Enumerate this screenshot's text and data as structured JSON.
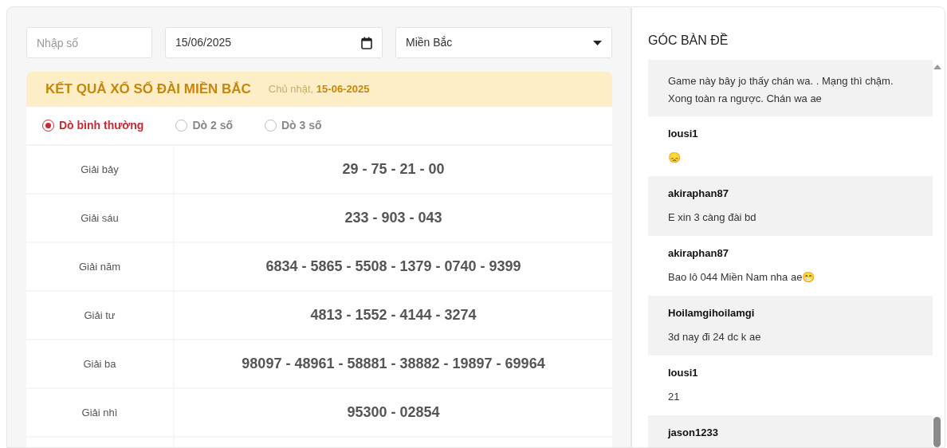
{
  "filters": {
    "number": {
      "placeholder": "Nhập số"
    },
    "date": {
      "value": "15/06/2025"
    },
    "region": {
      "value": "Miền Bắc"
    }
  },
  "results": {
    "title": "KẾT QUẢ XỔ SỐ ĐÀI MIỀN BẮC",
    "day": "Chủ nhật,",
    "date": "15-06-2025",
    "modes": [
      {
        "label": "Dò bình thường",
        "selected": true
      },
      {
        "label": "Dò 2 số",
        "selected": false
      },
      {
        "label": "Dò 3 số",
        "selected": false
      }
    ],
    "rows": [
      {
        "prize": "Giải bảy",
        "numbers": "29 - 75 - 21 - 00"
      },
      {
        "prize": "Giải sáu",
        "numbers": "233 - 903 - 043"
      },
      {
        "prize": "Giải năm",
        "numbers": "6834 - 5865 - 5508 - 1379 - 0740 - 9399"
      },
      {
        "prize": "Giải tư",
        "numbers": "4813 - 1552 - 4144 - 3274"
      },
      {
        "prize": "Giải ba",
        "numbers": "98097 - 48961 - 58881 - 38882 - 19897 - 69964"
      },
      {
        "prize": "Giải nhì",
        "numbers": "95300 - 02854"
      }
    ]
  },
  "chat": {
    "title": "GÓC BÀN ĐỀ",
    "messages": [
      {
        "text": "Game này bây jo thấy chán wa. . Mạng thì chậm. Xong toàn ra ngược. Chán wa ae"
      },
      {
        "user": "lousi1",
        "text": "😞"
      },
      {
        "user": "akiraphan87",
        "text": "E xin 3 càng đài bd"
      },
      {
        "user": "akiraphan87",
        "text": "Bao lô 044 Miền Nam nha ae😁"
      },
      {
        "user": "Hoilamgihoilamgi",
        "text": "3d nay đi 24 dc k ae"
      },
      {
        "user": "lousi1",
        "text": "21"
      },
      {
        "user": "jason1233"
      }
    ]
  }
}
